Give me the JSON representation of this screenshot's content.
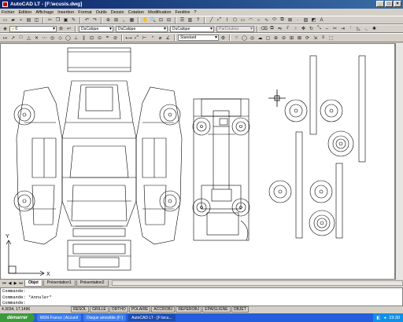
{
  "window": {
    "title": "AutoCAD LT - [F:\\ecusis.dwg]"
  },
  "menu": [
    "Fichier",
    "Edition",
    "Affichage",
    "Insertion",
    "Format",
    "Outils",
    "Dessin",
    "Cotation",
    "Modification",
    "Fenêtre",
    "?"
  ],
  "layer_toolbar": {
    "layer_value": "0",
    "color_value": "DuCalque",
    "linetype_value": "DuCalque",
    "lineweight_value": "DuCalque",
    "plotstyle_value": "ParCouleur"
  },
  "style_toolbar": {
    "dimstyle_value": "Standard"
  },
  "layout_tabs": [
    "Objet",
    "Présentation1",
    "Présentation2"
  ],
  "command_lines": [
    "Commande:",
    "Commande: *Annuler*",
    "Commande:"
  ],
  "status": {
    "coordinates": "4.3034, 17.1496",
    "modes": [
      "RESOL",
      "GRILLE",
      "ORTHO",
      "POLAIRE",
      "ACCROBJ",
      "REPEROBJ",
      "EPAISLIGNE",
      "OBJET"
    ]
  },
  "taskbar": {
    "start_label": "démarrer",
    "tasks": [
      "MSN France | Accueil",
      "Disque amovible (F:)",
      "AutoCAD LT - [F:\\ecu..."
    ],
    "clock": "19:30"
  },
  "ucs": {
    "x_label": "X",
    "y_label": "Y"
  },
  "colors": {
    "title_start": "#0a246a",
    "title_end": "#3a6ea5",
    "canvas": "#ffffff",
    "taskbar": "#245edc",
    "start": "#3c9a3c"
  }
}
